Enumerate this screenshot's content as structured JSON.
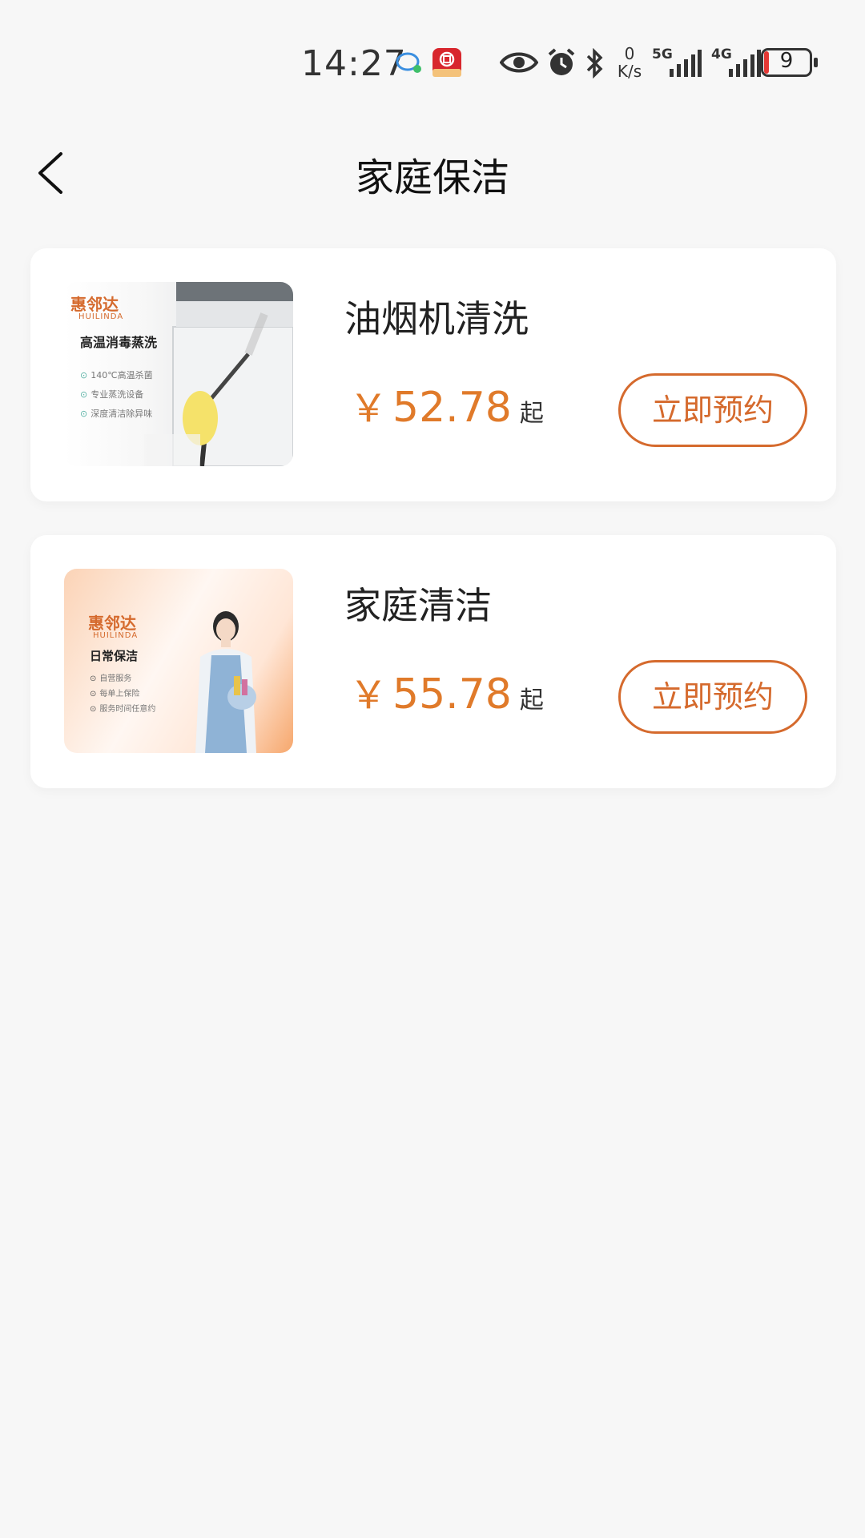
{
  "status_bar": {
    "time": "14:27",
    "net_speed_value": "0",
    "net_speed_unit": "K/s",
    "sig1": "5G",
    "sig2": "4G",
    "battery": "9"
  },
  "header": {
    "title": "家庭保洁"
  },
  "services": [
    {
      "title": "油烟机清洗",
      "currency": "￥",
      "price": "52.78",
      "suffix": "起",
      "button_label": "立即预约",
      "thumb": {
        "brand": "惠邻达",
        "brand_en": "HUILINDA",
        "headline": "高温消毒蒸洗",
        "bullets": [
          "140℃高温杀菌",
          "专业蒸洗设备",
          "深度清洁除异味"
        ]
      }
    },
    {
      "title": "家庭清洁",
      "currency": "￥",
      "price": "55.78",
      "suffix": "起",
      "button_label": "立即预约",
      "thumb": {
        "brand": "惠邻达",
        "brand_en": "HUILINDA",
        "headline": "日常保洁",
        "bullets": [
          "自营服务",
          "每单上保险",
          "服务时间任意约"
        ]
      }
    }
  ],
  "colors": {
    "accent": "#d56a2d",
    "price": "#e07a2a",
    "background": "#f7f7f7"
  }
}
